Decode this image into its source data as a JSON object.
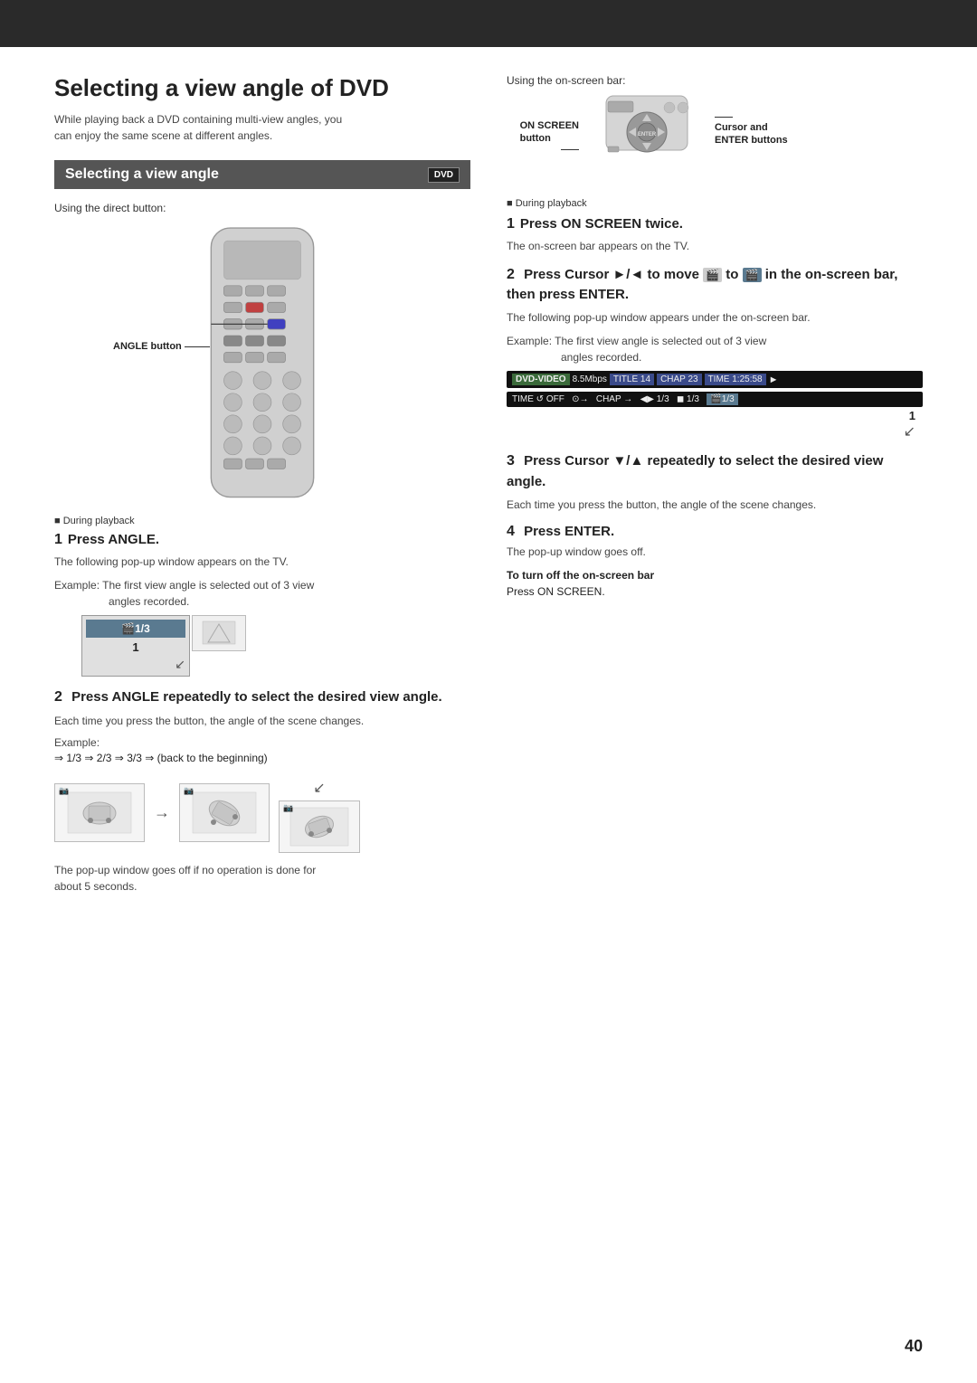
{
  "header": {
    "bg_color": "#2a2a2a"
  },
  "page": {
    "title": "Selecting a view angle of DVD",
    "subtitle_line1": "While playing back a DVD containing multi-view angles, you",
    "subtitle_line2": "can enjoy the same scene at different angles.",
    "section_title": "Selecting a view angle",
    "dvd_badge": "DVD",
    "page_number": "40"
  },
  "left": {
    "direct_button_label": "Using the direct button:",
    "angle_button_label": "ANGLE button",
    "during_playback": "During playback",
    "step1_number": "1",
    "step1_title": "Press ANGLE.",
    "step1_desc": "The following pop-up window appears on the TV.",
    "step1_example": "Example:  The first view angle is selected out of 3 view",
    "step1_example2": "angles recorded.",
    "popup_angle": "🎬1/3",
    "popup_num": "1",
    "step2_number": "2",
    "step2_title": "Press ANGLE repeatedly to select the desired view angle.",
    "step2_desc": "Each time you press the button, the angle of the scene changes.",
    "example_label": "Example:",
    "formula": "⇒ 1/3 ⇒ 2/3 ⇒ 3/3 ⇒ (back to the beginning)",
    "popup_note_line1": "The pop-up window goes off if no operation is done for",
    "popup_note_line2": "about 5 seconds."
  },
  "right": {
    "onscreen_bar_label": "Using the on-screen bar:",
    "on_screen_label_line1": "ON SCREEN",
    "on_screen_label_line2": "button",
    "cursor_label_line1": "Cursor and",
    "cursor_label_line2": "ENTER buttons",
    "during_playback": "During playback",
    "step1_number": "1",
    "step1_title": "Press ON SCREEN twice.",
    "step1_desc": "The on-screen bar appears on the TV.",
    "step2_number": "2",
    "step2_title_part1": "Press Cursor ►/◄ to move",
    "step2_title_icon": "🎬",
    "step2_title_part2": "to",
    "step2_title_icon2": "🎬",
    "step2_title_part3": "in the on-screen bar, then press ENTER.",
    "step2_desc": "The following pop-up window appears under the on-screen bar.",
    "step2_example": "Example:  The first view angle is selected out of 3 view",
    "step2_example2": "angles recorded.",
    "dvd_bar_text": "DVD-VIDEO  8.5Mbps    TITLE 14  CHAP 23  TIME 1:25:58  ►",
    "dvd_bar2_text": "TIME ↺ OFF  ⊙→  CHAP →  ◀▶  1/3  ◼  1/3  🎬1/3",
    "angle_num": "1",
    "step3_number": "3",
    "step3_title": "Press Cursor ▼/▲ repeatedly to select the desired view angle.",
    "step3_desc": "Each time you press the button, the angle of the scene changes.",
    "step4_number": "4",
    "step4_title": "Press ENTER.",
    "step4_desc": "The pop-up window goes off.",
    "turn_off_label": "To turn off the on-screen bar",
    "turn_off_desc": "Press ON SCREEN."
  }
}
